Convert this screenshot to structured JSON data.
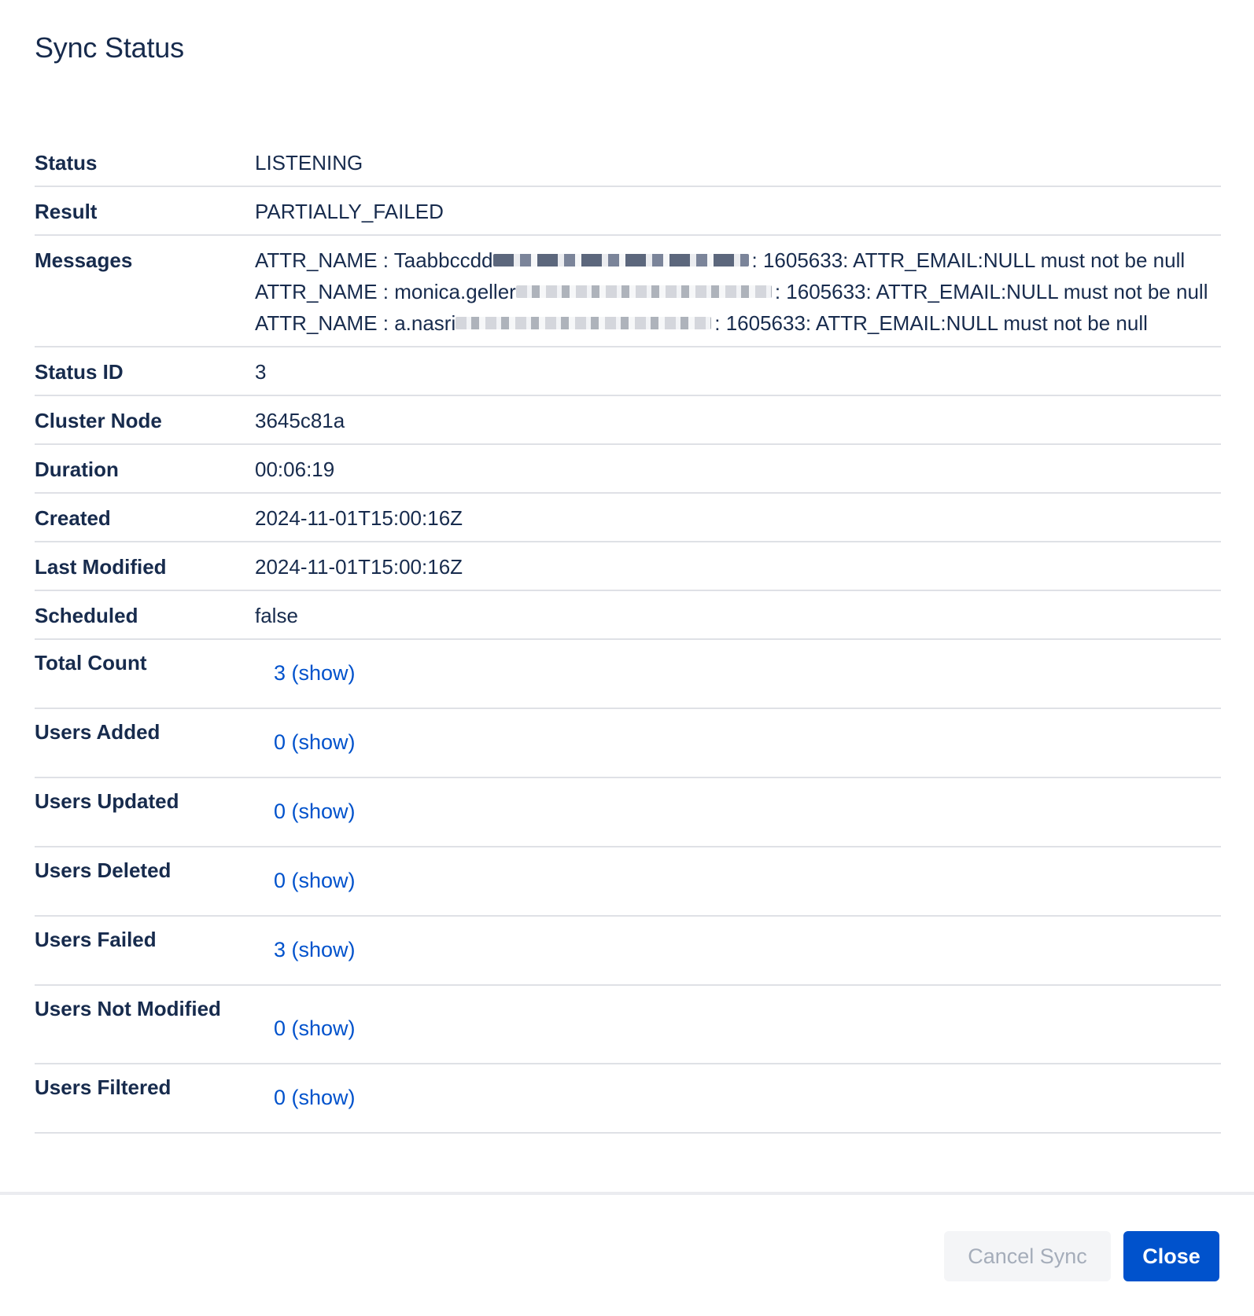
{
  "dialog": {
    "title": "Sync Status"
  },
  "details": {
    "status": {
      "label": "Status",
      "value": "LISTENING"
    },
    "result": {
      "label": "Result",
      "value": "PARTIALLY_FAILED"
    },
    "messages": {
      "label": "Messages",
      "lines": [
        {
          "prefix": "ATTR_NAME : Taabbccdd",
          "suffix": ": 1605633: ATTR_EMAIL:NULL must not be null"
        },
        {
          "prefix": "ATTR_NAME : monica.geller",
          "suffix": ": 1605633: ATTR_EMAIL:NULL must not be null"
        },
        {
          "prefix": "ATTR_NAME : a.nasri",
          "suffix": ": 1605633: ATTR_EMAIL:NULL must not be null"
        }
      ]
    },
    "status_id": {
      "label": "Status ID",
      "value": "3"
    },
    "cluster_node": {
      "label": "Cluster Node",
      "value": "3645c81a"
    },
    "duration": {
      "label": "Duration",
      "value": "00:06:19"
    },
    "created": {
      "label": "Created",
      "value": "2024-11-01T15:00:16Z"
    },
    "last_modified": {
      "label": "Last Modified",
      "value": "2024-11-01T15:00:16Z"
    },
    "scheduled": {
      "label": "Scheduled",
      "value": "false"
    }
  },
  "counts": [
    {
      "label": "Total Count",
      "link": "3 (show)"
    },
    {
      "label": "Users Added",
      "link": "0 (show)"
    },
    {
      "label": "Users Updated",
      "link": "0 (show)"
    },
    {
      "label": "Users Deleted",
      "link": "0 (show)"
    },
    {
      "label": "Users Failed",
      "link": "3 (show)"
    },
    {
      "label": "Users Not Modified",
      "link": "0 (show)"
    },
    {
      "label": "Users Filtered",
      "link": "0 (show)"
    }
  ],
  "footer": {
    "cancel_label": "Cancel Sync",
    "close_label": "Close"
  },
  "colors": {
    "text": "#172b4d",
    "link": "#0052cc",
    "primary_button": "#0052cc",
    "disabled_button_bg": "#f4f5f7",
    "disabled_button_text": "#a5adba",
    "divider": "#dfe1e6"
  }
}
